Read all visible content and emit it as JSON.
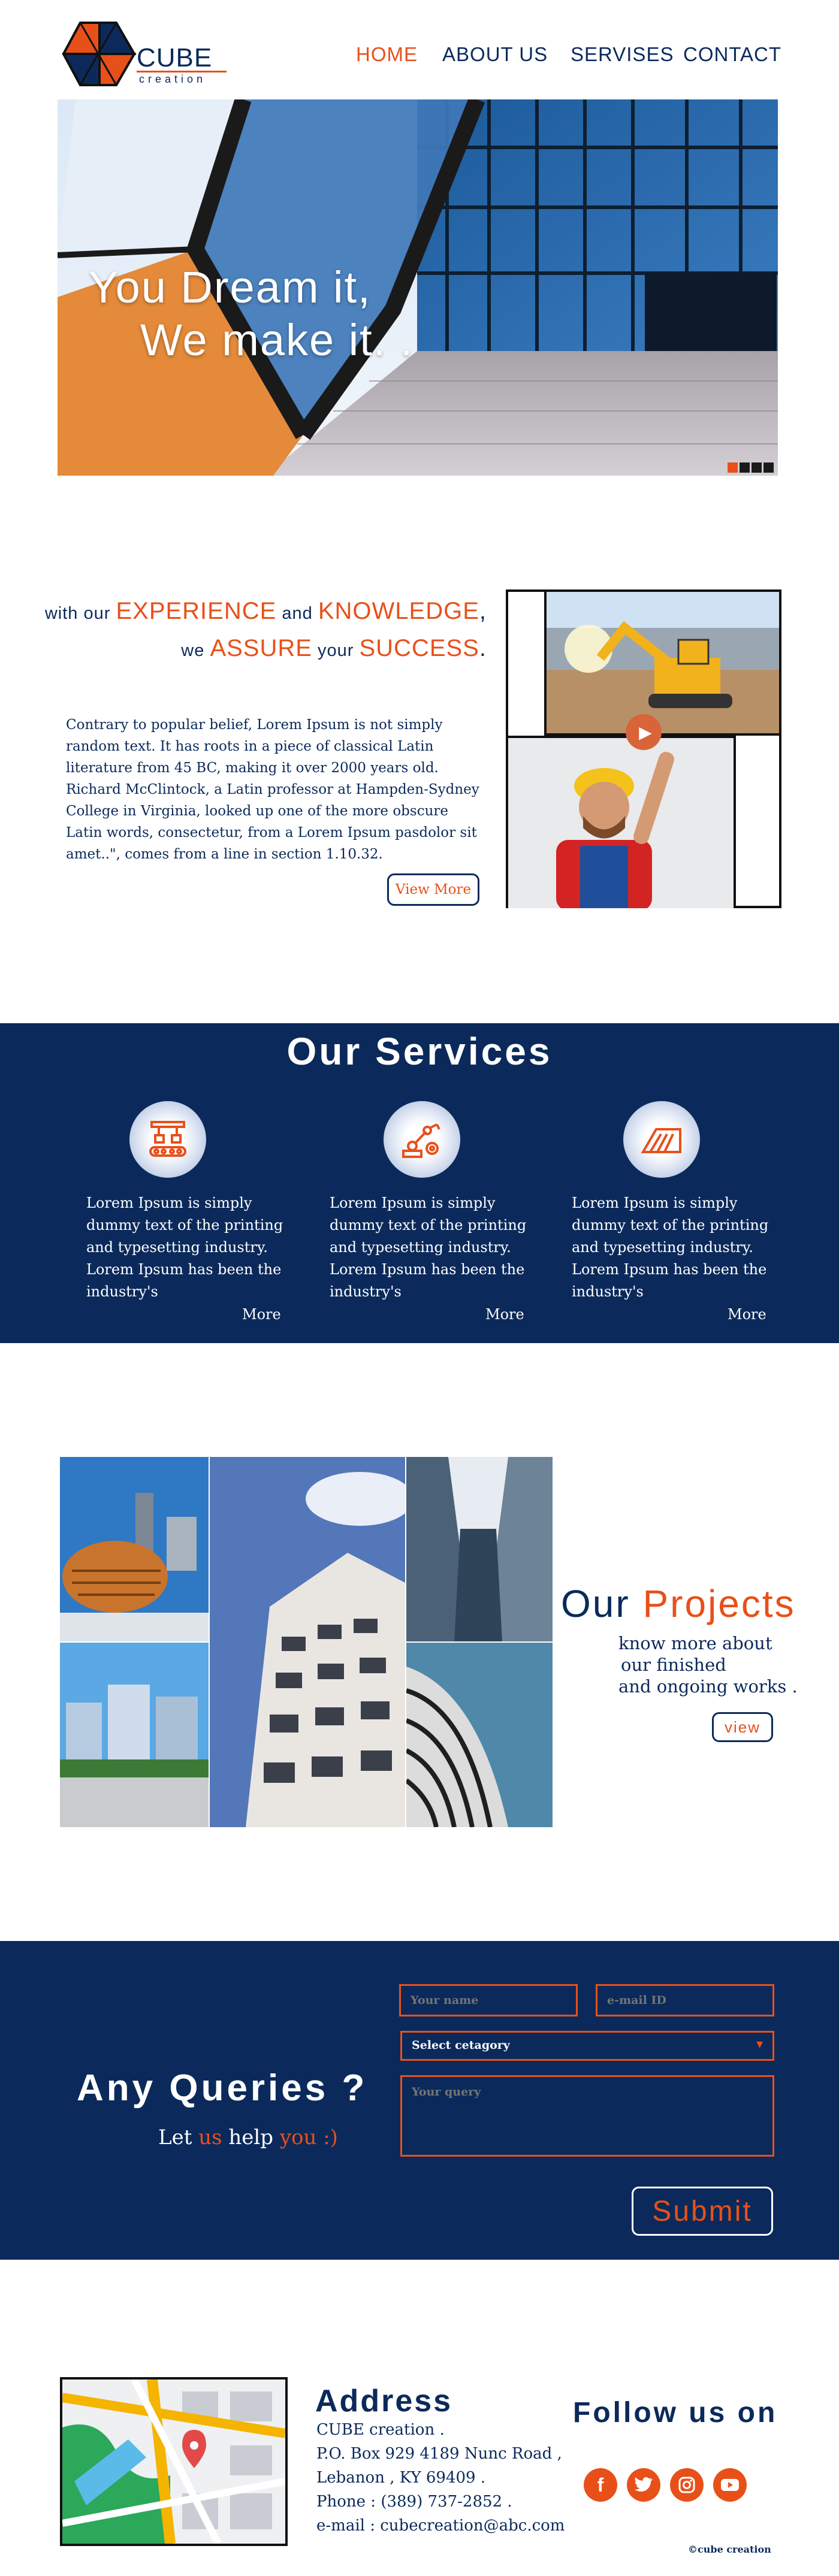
{
  "brand": {
    "name": "CUBE",
    "tagline": "creation",
    "navy": "#0b2a5b",
    "orange": "#e8501a"
  },
  "nav": [
    {
      "label": "HOME",
      "active": true
    },
    {
      "label": "ABOUT US",
      "active": false
    },
    {
      "label": "SERVISES",
      "active": false
    },
    {
      "label": "CONTACT",
      "active": false
    }
  ],
  "hero": {
    "line1": "You Dream it,",
    "line2": "We make it. .",
    "slides_total": 4,
    "slide_active": 1
  },
  "intro": {
    "line1_pre": "with our",
    "line1_word1": "EXPERIENCE",
    "line1_mid": "and",
    "line1_word2": "KNOWLEDGE",
    "line1_end": ",",
    "line2_pre": "we",
    "line2_word1": "ASSURE",
    "line2_mid": "your",
    "line2_word2": "SUCCESS",
    "line2_end": ".",
    "body": "Contrary to popular belief, Lorem Ipsum is not simply random text. It has roots in a piece of classical Latin literature from 45 BC, making it over 2000 years old. Richard McClintock, a Latin professor at Hampden-Sydney College in Virginia, looked up one of the more obscure Latin words, consectetur, from a Lorem Ipsum pasdolor sit amet..\", comes from a line in section 1.10.32.",
    "button": "View More"
  },
  "services": {
    "title": "Our Services",
    "items": [
      {
        "icon": "conveyor-machine-icon",
        "text": "Lorem Ipsum is simply dummy text of the printing and typesetting industry. Lorem Ipsum has been the industry's",
        "more": "More"
      },
      {
        "icon": "robotic-arm-icon",
        "text": "Lorem Ipsum is simply dummy text of the printing and typesetting industry. Lorem Ipsum has been the industry's",
        "more": "More"
      },
      {
        "icon": "building-blueprint-icon",
        "text": "Lorem Ipsum is simply dummy text of the printing and typesetting industry. Lorem Ipsum has been the industry's",
        "more": "More"
      }
    ]
  },
  "projects": {
    "title_word1": "Our",
    "title_word2": "Projects",
    "sub1": "know more about",
    "sub2": "our finished",
    "sub3": "and ongoing works .",
    "button": "view"
  },
  "queries": {
    "title": "Any Queries ?",
    "sub_pre": "Let",
    "sub_us": "us",
    "sub_mid": "help",
    "sub_you": "you :)",
    "name_placeholder": "Your name",
    "email_placeholder": "e-mail ID",
    "category_selected": "Select cetagory",
    "query_placeholder": "Your query",
    "submit": "Submit"
  },
  "footer": {
    "address_title": "Address",
    "lines": [
      "CUBE creation .",
      "P.O. Box 929 4189 Nunc Road ,",
      "Lebanon , KY 69409 .",
      "Phone : (389) 737-2852 .",
      "e-mail : cubecreation@abc.com"
    ],
    "follow_title": "Follow us on",
    "socials": [
      "facebook-icon",
      "twitter-icon",
      "instagram-icon",
      "youtube-icon"
    ],
    "copyright": "©cube creation"
  }
}
